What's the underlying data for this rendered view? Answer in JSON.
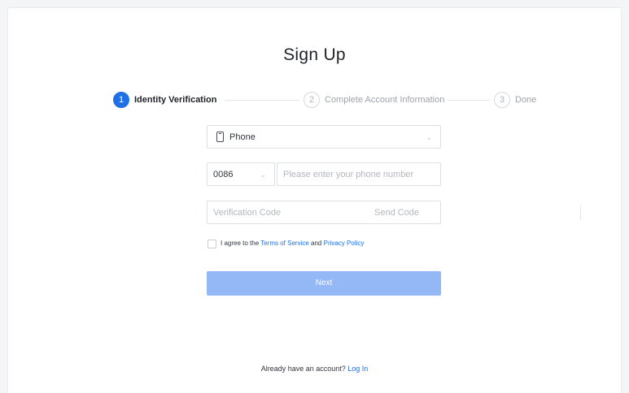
{
  "page": {
    "title": "Sign Up"
  },
  "steps": [
    {
      "number": "1",
      "label": "Identity Verification",
      "state": "active"
    },
    {
      "number": "2",
      "label": "Complete Account Information",
      "state": "idle"
    },
    {
      "number": "3",
      "label": "Done",
      "state": "idle"
    }
  ],
  "form": {
    "method_select": {
      "value": "Phone",
      "icon": "phone-icon"
    },
    "country_code": {
      "value": "0086"
    },
    "phone_input": {
      "placeholder": "Please enter your phone number"
    },
    "code_input": {
      "placeholder": "Verification Code"
    },
    "send_code_label": "Send Code",
    "agree": {
      "prefix": "I agree to the ",
      "terms": "Terms of Service",
      "and": " and ",
      "privacy": "Privacy Policy"
    },
    "next_label": "Next"
  },
  "footer": {
    "prompt": "Already have an account?",
    "login_link": "Log In"
  },
  "colors": {
    "accent": "#1f6fe5",
    "button_disabled": "#94b7f5"
  }
}
